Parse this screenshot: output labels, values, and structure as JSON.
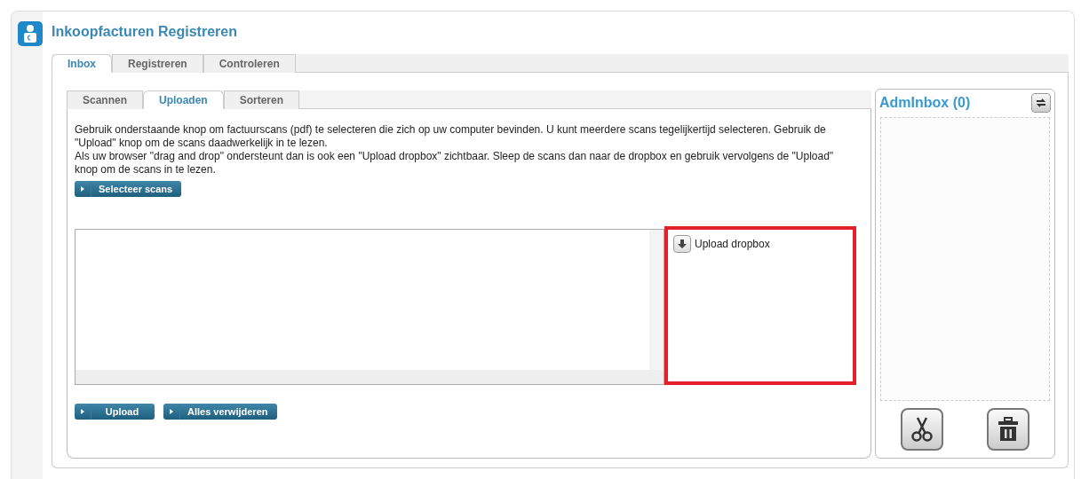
{
  "title": "Inkoopfacturen Registreren",
  "tabs": [
    {
      "label": "Inbox",
      "selected": true
    },
    {
      "label": "Registreren",
      "selected": false
    },
    {
      "label": "Controleren",
      "selected": false
    }
  ],
  "subtabs": [
    {
      "label": "Scannen",
      "selected": false
    },
    {
      "label": "Uploaden",
      "selected": true
    },
    {
      "label": "Sorteren",
      "selected": false
    }
  ],
  "instructions": [
    "Gebruik onderstaande knop om factuurscans (pdf) te selecteren die zich op uw computer bevinden. U kunt meerdere scans tegelijkertijd selecteren. Gebruik de \"Upload\" knop om de scans daadwerkelijk in te lezen.",
    "Als uw browser \"drag and drop\" ondersteunt dan is ook een \"Upload dropbox\" zichtbaar. Sleep de scans dan naar de dropbox en gebruik vervolgens de \"Upload\" knop om de scans in te lezen."
  ],
  "select_button": "Selecteer scans",
  "dropbox": {
    "label": "Upload dropbox"
  },
  "actions": [
    "Upload",
    "Alles verwijderen"
  ],
  "admin_inbox": {
    "title": "AdmInbox (0)"
  }
}
